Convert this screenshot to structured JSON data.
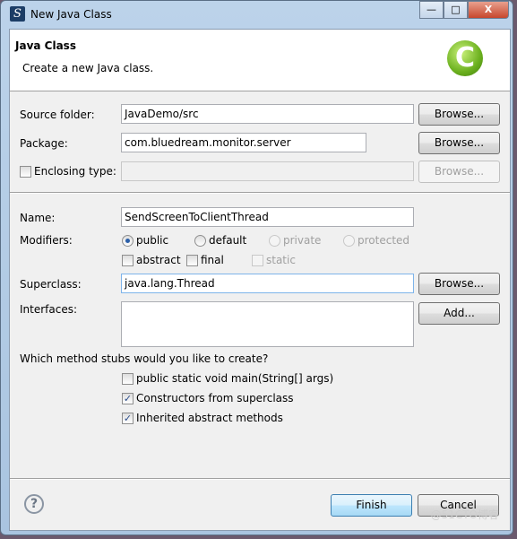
{
  "window": {
    "title": "New Java Class",
    "minimize": "—",
    "maximize": "□",
    "close": "X"
  },
  "header": {
    "title": "Java Class",
    "description": "Create a new Java class.",
    "icon": "class-c-icon",
    "icon_glyph": "C"
  },
  "form": {
    "source_folder": {
      "label": "Source folder:",
      "value": "JavaDemo/src",
      "button": "Browse..."
    },
    "package": {
      "label": "Package:",
      "value": "com.bluedream.monitor.server",
      "button": "Browse..."
    },
    "enclosing_type": {
      "label": "Enclosing type:",
      "checked": false,
      "value": "",
      "button": "Browse..."
    },
    "name": {
      "label": "Name:",
      "value": "SendScreenToClientThread"
    },
    "modifiers": {
      "label": "Modifiers:",
      "public": "public",
      "default": "default",
      "private": "private",
      "protected": "protected",
      "selected": "public",
      "abstract": "abstract",
      "final": "final",
      "static": "static"
    },
    "superclass": {
      "label": "Superclass:",
      "value": "java.lang.Thread",
      "button": "Browse..."
    },
    "interfaces": {
      "label": "Interfaces:",
      "add_button": "Add..."
    },
    "stubs": {
      "question": "Which method stubs would you like to create?",
      "items": [
        {
          "label": "public static void main(String[] args)",
          "checked": false
        },
        {
          "label": "Constructors from superclass",
          "checked": true
        },
        {
          "label": "Inherited abstract methods",
          "checked": true
        }
      ]
    }
  },
  "footer": {
    "finish": "Finish",
    "cancel": "Cancel",
    "help": "?"
  },
  "watermark": "@51CTO博客"
}
